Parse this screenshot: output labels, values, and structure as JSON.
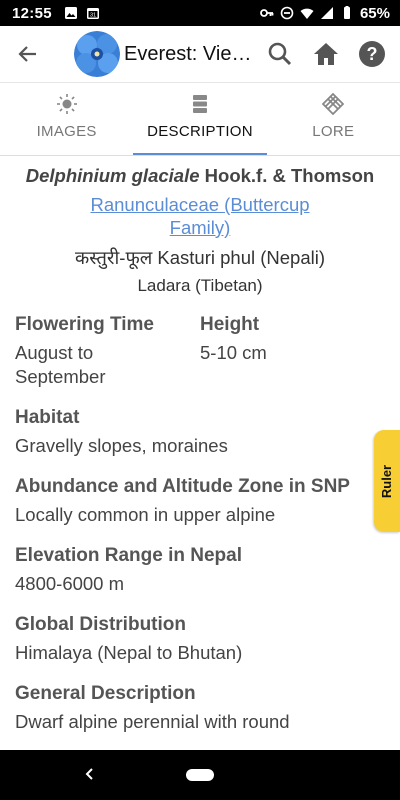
{
  "status": {
    "time": "12:55",
    "battery": "65%"
  },
  "header": {
    "title": "Everest: Vie…"
  },
  "tabs": [
    {
      "label": "IMAGES",
      "icon": "sun-burst-icon"
    },
    {
      "label": "DESCRIPTION",
      "icon": "server-stack-icon"
    },
    {
      "label": "LORE",
      "icon": "endless-knot-icon"
    }
  ],
  "plant": {
    "genus_species": "Delphinium glaciale",
    "author": "Hook.f. & Thomson",
    "family": "Ranunculaceae (Buttercup Family)",
    "local_name": "कस्तुरी-फूल Kasturi phul (Nepali)",
    "tibetan_name": "Ladara (Tibetan)"
  },
  "fields": {
    "flowering_time": {
      "label": "Flowering Time",
      "value": "August to September"
    },
    "height": {
      "label": "Height",
      "value": "5-10 cm"
    },
    "habitat": {
      "label": "Habitat",
      "value": "Gravelly slopes, moraines"
    },
    "abundance": {
      "label": "Abundance and Altitude Zone in SNP",
      "value": "Locally common in upper alpine"
    },
    "elevation": {
      "label": "Elevation Range in Nepal",
      "value": "4800-6000 m"
    },
    "distribution": {
      "label": "Global Distribution",
      "value": "Himalaya (Nepal to Bhutan)"
    },
    "general": {
      "label": "General Description",
      "value": "Dwarf alpine perennial with round"
    }
  },
  "ruler": {
    "label": "Ruler"
  },
  "colors": {
    "accent": "#5b8dd6",
    "ruler": "#f7cf35"
  }
}
